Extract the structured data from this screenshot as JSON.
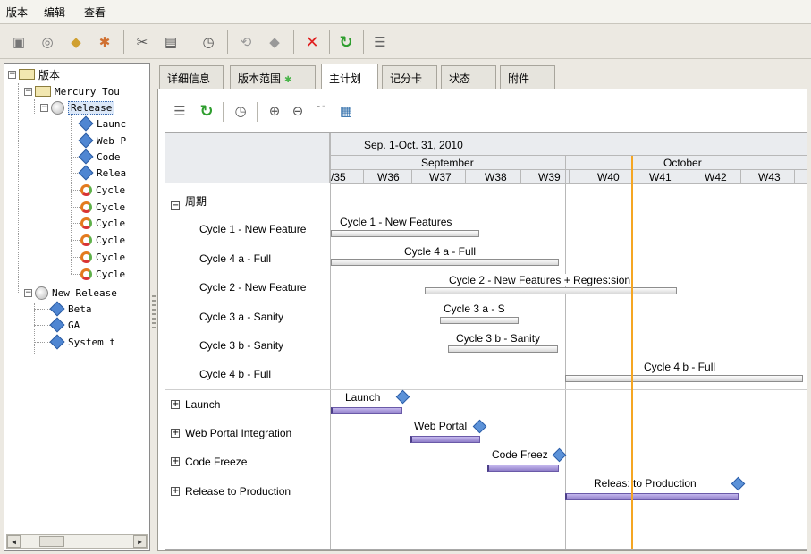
{
  "menu": [
    "版本",
    "编辑",
    "查看"
  ],
  "toolbar_icons": [
    "new-folder-icon",
    "new-release-icon",
    "new-cycle-icon",
    "add-icon",
    "cut-icon",
    "paste-icon",
    "schedule-icon",
    "assign-icon",
    "link-icon",
    "delete-icon",
    "refresh-icon",
    "details-icon"
  ],
  "tree": {
    "root": "版本",
    "folder": "Mercury Tou",
    "release1": "Release",
    "release1_children": [
      {
        "label": "Launc",
        "type": "milestone"
      },
      {
        "label": "Web P",
        "type": "milestone"
      },
      {
        "label": "Code",
        "type": "milestone"
      },
      {
        "label": "Relea",
        "type": "milestone"
      },
      {
        "label": "Cycle",
        "type": "cycle"
      },
      {
        "label": "Cycle",
        "type": "cycle"
      },
      {
        "label": "Cycle",
        "type": "cycle"
      },
      {
        "label": "Cycle",
        "type": "cycle"
      },
      {
        "label": "Cycle",
        "type": "cycle"
      },
      {
        "label": "Cycle",
        "type": "cycle"
      }
    ],
    "release2": "New Release",
    "release2_children": [
      {
        "label": "Beta"
      },
      {
        "label": "GA"
      },
      {
        "label": "System t"
      }
    ]
  },
  "tabs": [
    "详细信息",
    "版本范围",
    "主计划",
    "记分卡",
    "状态",
    "附件"
  ],
  "active_tab": "主计划",
  "gantt": {
    "header_range": "Sep. 1-Oct. 31, 2010",
    "months": [
      "September",
      "October"
    ],
    "weeks": [
      "/35",
      "W36",
      "W37",
      "W38",
      "W39",
      "W40",
      "W41",
      "W42",
      "W43"
    ],
    "cycles_group": "周期",
    "cycles": [
      {
        "row_label": "Cycle 1 - New Feature",
        "bar_label": "Cycle 1 - New Features"
      },
      {
        "row_label": "Cycle 4 a - Full",
        "bar_label": "Cycle 4 a - Full"
      },
      {
        "row_label": "Cycle 2 - New Feature",
        "bar_label": "Cycle 2 - New Features + Regres:sion"
      },
      {
        "row_label": "Cycle 3 a - Sanity",
        "bar_label": "Cycle 3 a - S"
      },
      {
        "row_label": "Cycle 3 b - Sanity",
        "bar_label": "Cycle 3 b - Sanity"
      },
      {
        "row_label": "Cycle 4 b - Full",
        "bar_label": "Cycle 4 b - Full"
      }
    ],
    "milestones": [
      {
        "row_label": "Launch",
        "bar_label": "Launch"
      },
      {
        "row_label": "Web Portal Integration",
        "bar_label": "Web Portal"
      },
      {
        "row_label": "Code Freeze",
        "bar_label": "Code Freez"
      },
      {
        "row_label": "Release to Production",
        "bar_label": "Releas: to Production"
      }
    ]
  },
  "colors": {
    "today_line": "#f5a623",
    "milestone_bar": "#8f7ec9",
    "milestone_diamond": "#5c92d8",
    "delete_icon": "#e02020",
    "refresh_icon": "#2f9e2f"
  }
}
